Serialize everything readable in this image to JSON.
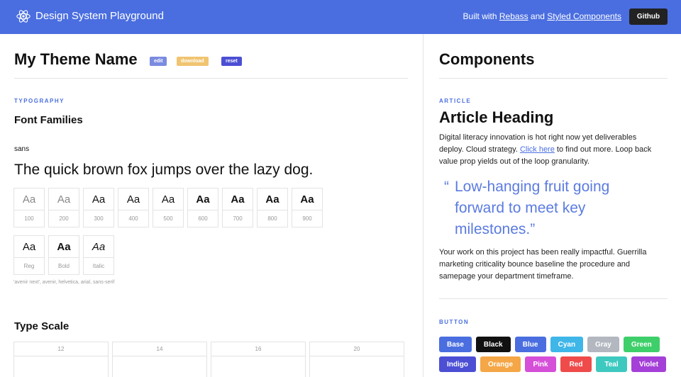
{
  "header": {
    "title": "Design System Playground",
    "built_prefix": "Built with ",
    "link_rebass": "Rebass",
    "built_and": " and ",
    "link_styled": "Styled Components",
    "github_label": "Github"
  },
  "theme": {
    "name": "My Theme Name",
    "actions": {
      "edit": "edit",
      "download": "download",
      "reset": "reset"
    }
  },
  "typography": {
    "eyebrow": "TYPOGRAPHY",
    "families_heading": "Font Families",
    "family_name": "sans",
    "pangram": "The quick brown fox jumps over the lazy dog.",
    "sample": "Aa",
    "weights": [
      "100",
      "200",
      "300",
      "400",
      "500",
      "600",
      "700",
      "800",
      "900"
    ],
    "styles": [
      "Reg",
      "Bold",
      "Italic"
    ],
    "font_stack": "'avenir next', avenir, helvetica, arial, sans-serif"
  },
  "type_scale": {
    "heading": "Type Scale",
    "sizes": [
      "12",
      "14",
      "16",
      "20"
    ]
  },
  "components": {
    "title": "Components",
    "article": {
      "eyebrow": "ARTICLE",
      "heading": "Article Heading",
      "para1_before": "Digital literacy innovation is hot right now yet deliverables deploy. Cloud strategy. ",
      "para1_link": "Click here",
      "para1_after": " to find out more. Loop back value prop yields out of the loop granularity.",
      "quote_open": "“",
      "quote": "Low-hanging fruit going forward to meet key milestones.”",
      "para2": "Your work on this project has been really impactful. Guerrilla marketing criticality bounce baseline the procedure and samepage your department timeframe."
    },
    "button": {
      "eyebrow": "BUTTON",
      "items": [
        {
          "label": "Base",
          "color": "#4a6ee0"
        },
        {
          "label": "Black",
          "color": "#111111"
        },
        {
          "label": "Blue",
          "color": "#4a6ee0"
        },
        {
          "label": "Cyan",
          "color": "#3fb6e8"
        },
        {
          "label": "Gray",
          "color": "#b3b7bf"
        },
        {
          "label": "Green",
          "color": "#3ecf6a"
        },
        {
          "label": "Indigo",
          "color": "#4c4fd4"
        },
        {
          "label": "Orange",
          "color": "#f5a646"
        },
        {
          "label": "Pink",
          "color": "#d54fd8"
        },
        {
          "label": "Red",
          "color": "#ef4b4b"
        },
        {
          "label": "Teal",
          "color": "#3ec9c0"
        },
        {
          "label": "Violet",
          "color": "#a43fd8"
        }
      ]
    }
  }
}
